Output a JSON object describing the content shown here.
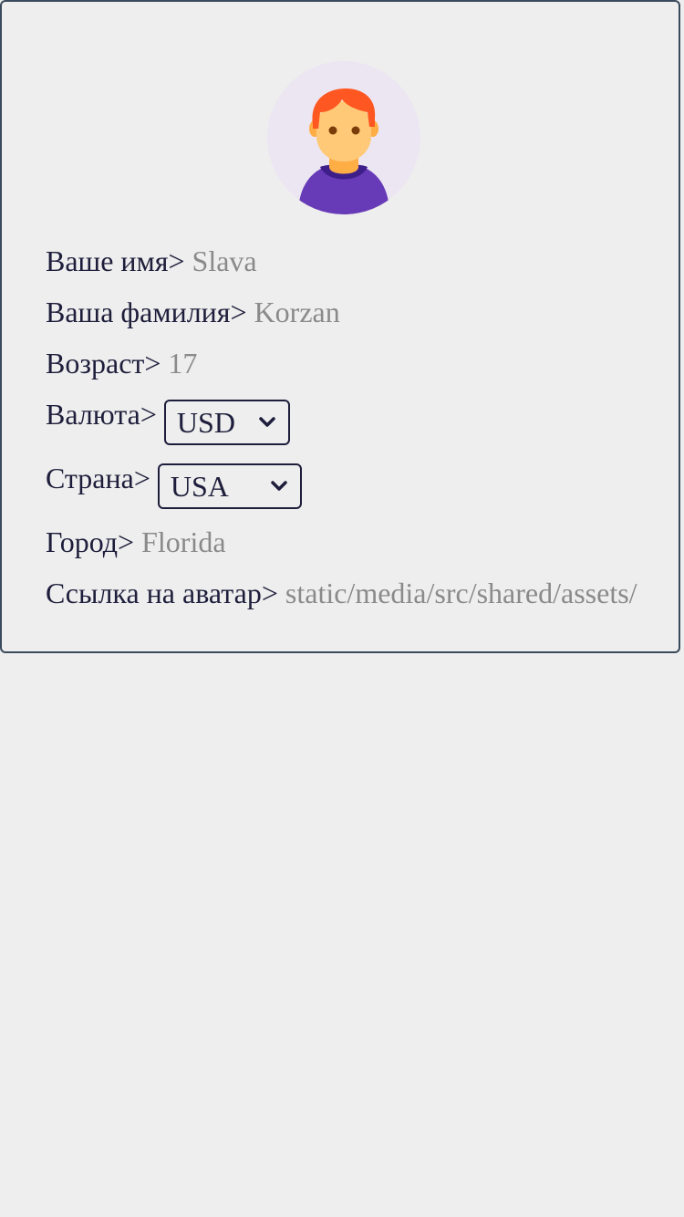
{
  "profile": {
    "avatar_icon": "user-avatar-icon",
    "fields": {
      "first_name": {
        "label": "Ваше имя>",
        "value": "Slava"
      },
      "last_name": {
        "label": "Ваша фамилия>",
        "value": "Korzan"
      },
      "age": {
        "label": "Возраст>",
        "value": "17"
      },
      "currency": {
        "label": "Валюта>",
        "selected": "USD"
      },
      "country": {
        "label": "Страна>",
        "selected": "USA"
      },
      "city": {
        "label": "Город>",
        "value": "Florida"
      },
      "avatar_link": {
        "label": "Ссылка на аватар>",
        "value": "static/media/src/shared/assets/"
      }
    }
  },
  "colors": {
    "border": "#3a4a5c",
    "text": "#1e1e3c",
    "value_text": "#8a8a8a",
    "avatar_bg": "#ece6f2",
    "hair": "#ff5722",
    "skin": "#ffc977",
    "shirt": "#673ab7"
  }
}
